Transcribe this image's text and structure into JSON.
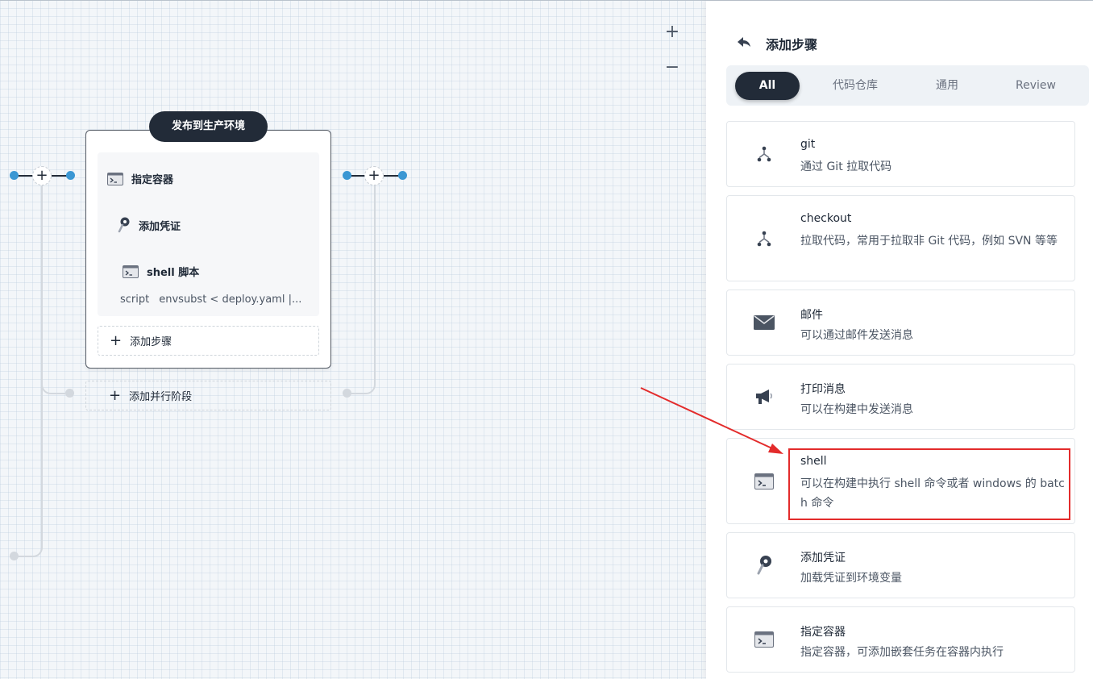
{
  "canvas": {
    "zoom_in": "+",
    "zoom_out": "−",
    "stage": {
      "title": "发布到生产环境",
      "steps": [
        {
          "label": "指定容器",
          "icon": "terminal-icon"
        },
        {
          "label": "添加凭证",
          "icon": "key-icon"
        },
        {
          "label": "shell 脚本",
          "icon": "terminal-icon"
        }
      ],
      "script_key": "script",
      "script_value": "envsubst < deploy.yaml |...",
      "add_step": "添加步骤"
    },
    "add_parallel": "添加并行阶段"
  },
  "panel": {
    "title": "添加步骤",
    "tabs": [
      {
        "label": "All",
        "active": true
      },
      {
        "label": "代码仓库",
        "active": false
      },
      {
        "label": "通用",
        "active": false
      },
      {
        "label": "Review",
        "active": false
      }
    ],
    "items": [
      {
        "title": "git",
        "desc": "通过 Git 拉取代码",
        "icon": "git-branch-icon"
      },
      {
        "title": "checkout",
        "desc": "拉取代码，常用于拉取非 Git 代码，例如 SVN 等等",
        "icon": "git-branch-icon"
      },
      {
        "title": "邮件",
        "desc": "可以通过邮件发送消息",
        "icon": "mail-icon"
      },
      {
        "title": "打印消息",
        "desc": "可以在构建中发送消息",
        "icon": "megaphone-icon"
      },
      {
        "title": "shell",
        "desc": "可以在构建中执行 shell 命令或者 windows 的 batch 命令",
        "icon": "terminal-icon"
      },
      {
        "title": "添加凭证",
        "desc": "加载凭证到环境变量",
        "icon": "key-icon"
      },
      {
        "title": "指定容器",
        "desc": "指定容器，可添加嵌套任务在容器内执行",
        "icon": "terminal-icon"
      }
    ]
  },
  "colors": {
    "dark": "#222b38",
    "accent_blue": "#3b97d3",
    "annotation_red": "#e32b2b"
  }
}
